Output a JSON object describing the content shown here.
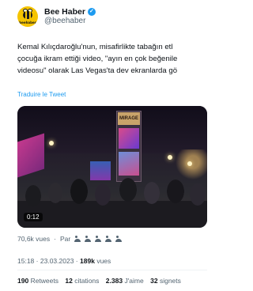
{
  "account": {
    "display_name": "Bee Haber",
    "handle": "@beehaber",
    "avatar_text": "beehaber"
  },
  "tweet": {
    "lines": [
      "Kemal Kılıçdaroğlu'nun, misafirlikte tabağın etl",
      "çocuğa ikram ettiği video, \"ayın en çok beğenile",
      "videosu\" olarak Las Vegas'ta dev ekranlarda gö"
    ],
    "translate_label": "Traduire le Tweet"
  },
  "media": {
    "duration": "0:12",
    "sign_text": "MIRAGE"
  },
  "views_row": {
    "views": "70,6k vues",
    "separator": "·",
    "by_label": "Par"
  },
  "meta": {
    "time": "15:18",
    "separator": "·",
    "date": "23.03.2023",
    "views_count": "189k",
    "views_label": "vues"
  },
  "stats": {
    "retweets_count": "190",
    "retweets_label": "Retweets",
    "quotes_count": "12",
    "quotes_label": "citations",
    "likes_count": "2.383",
    "likes_label": "J'aime",
    "bookmarks_count": "32",
    "bookmarks_label": "signets"
  }
}
